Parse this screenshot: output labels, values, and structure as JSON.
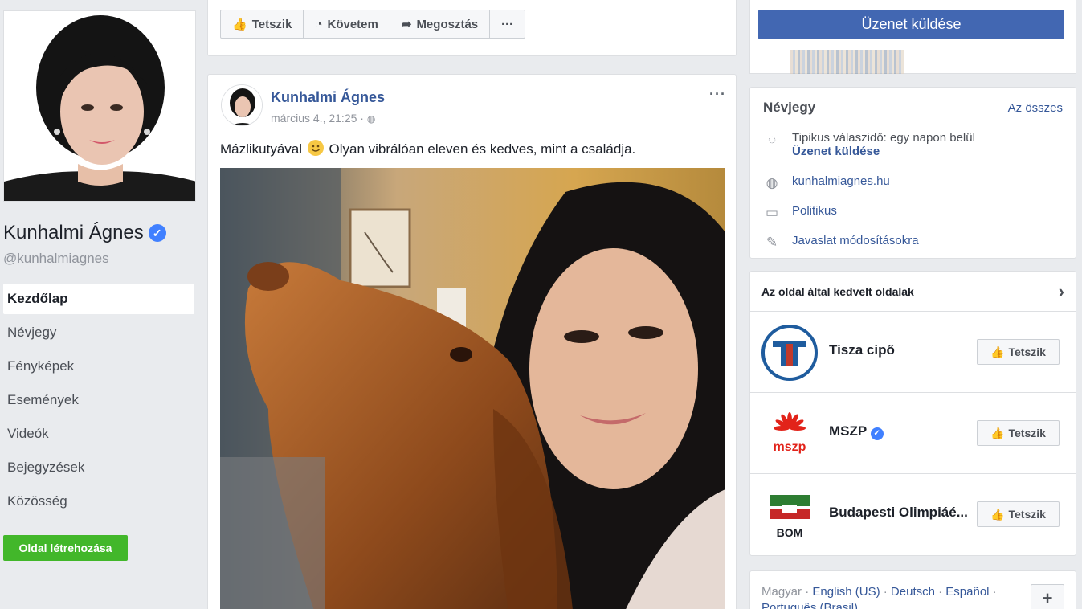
{
  "page": {
    "name": "Kunhalmi Ágnes",
    "handle": "@kunhalmiagnes"
  },
  "nav": {
    "items": [
      {
        "label": "Kezdőlap",
        "active": true
      },
      {
        "label": "Névjegy"
      },
      {
        "label": "Fényképek"
      },
      {
        "label": "Események"
      },
      {
        "label": "Videók"
      },
      {
        "label": "Bejegyzések"
      },
      {
        "label": "Közösség"
      }
    ],
    "create_button": "Oldal létrehozása"
  },
  "actions": {
    "like": "Tetszik",
    "follow": "Követem",
    "share": "Megosztás",
    "more": "···"
  },
  "post": {
    "author": "Kunhalmi Ágnes",
    "timestamp": "március 4., 21:25 · ",
    "text_before": "Mázlikutyával",
    "text_after": "Olyan vibrálóan eleven és kedves, mint a családja.",
    "menu": "···"
  },
  "sidebar": {
    "send_message": "Üzenet küldése",
    "about": {
      "title": "Névjegy",
      "see_all": "Az összes",
      "response": "Tipikus válaszidő: egy napon belül",
      "response_link": "Üzenet küldése",
      "website": "kunhalmiagnes.hu",
      "category": "Politikus",
      "suggest": "Javaslat módosításokra"
    },
    "liked_pages": {
      "title": "Az oldal által kedvelt oldalak",
      "items": [
        {
          "name": "Tisza cipő",
          "button": "Tetszik"
        },
        {
          "name": "MSZP",
          "button": "Tetszik"
        },
        {
          "name": "Budapesti Olimpiáé...",
          "button": "Tetszik"
        }
      ]
    },
    "languages": {
      "current": "Magyar",
      "others": [
        "English (US)",
        "Deutsch",
        "Español",
        "Português (Brasil)"
      ],
      "more_button": "+"
    }
  },
  "colors": {
    "brand_blue": "#4267b2",
    "link_blue": "#365899",
    "green": "#42b72a",
    "verified": "#4080ff"
  }
}
